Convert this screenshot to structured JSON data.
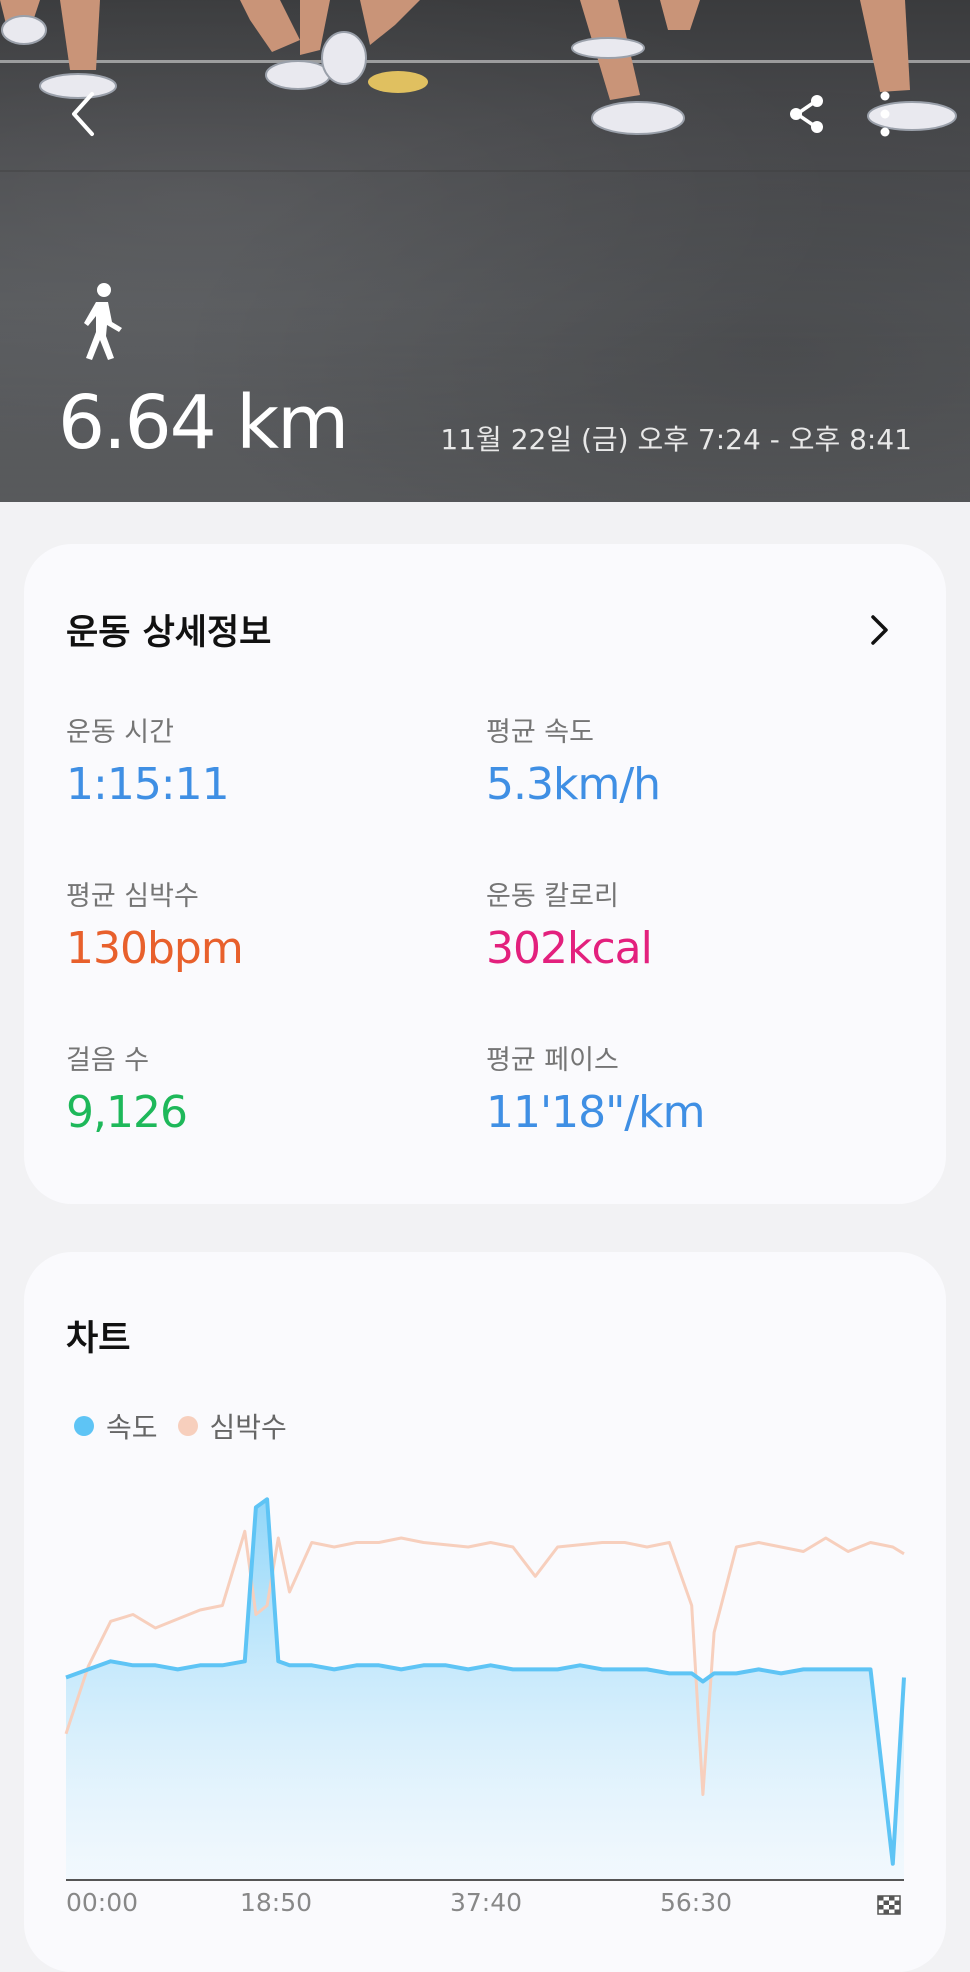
{
  "header": {
    "distance": "6.64 km",
    "datetime": "11월 22일 (금) 오후 7:24 - 오후 8:41",
    "icons": [
      "back-icon",
      "share-icon",
      "more-icon",
      "walking-icon"
    ]
  },
  "details": {
    "title": "운동 상세정보",
    "stats": {
      "duration": {
        "label": "운동 시간",
        "value": "1:15:11",
        "color": "#3f8fe4"
      },
      "avg_speed": {
        "label": "평균 속도",
        "value": "5.3km/h",
        "color": "#3f8fe4"
      },
      "avg_heart_rate": {
        "label": "평균 심박수",
        "value": "130bpm",
        "color": "#e8602c"
      },
      "calories": {
        "label": "운동 칼로리",
        "value": "302kcal",
        "color": "#e3207d"
      },
      "steps": {
        "label": "걸음 수",
        "value": "9,126",
        "color": "#1eb85a"
      },
      "avg_pace": {
        "label": "평균 페이스",
        "value": "11'18\"/km",
        "color": "#3f8fe4"
      }
    }
  },
  "chart": {
    "title": "차트",
    "legend": {
      "speed": "속도",
      "heart_rate": "심박수"
    },
    "colors": {
      "speed": "#5ec4f5",
      "heart_rate": "#f7cfbd"
    },
    "ticks": [
      "00:00",
      "18:50",
      "37:40",
      "56:30"
    ]
  },
  "chart_data": {
    "type": "area",
    "x": [
      0,
      2,
      4,
      6,
      8,
      10,
      12,
      14,
      16,
      17,
      18,
      19,
      20,
      22,
      24,
      26,
      28,
      30,
      32,
      34,
      36,
      38,
      40,
      42,
      44,
      46,
      48,
      50,
      52,
      54,
      56,
      57,
      58,
      60,
      62,
      64,
      66,
      68,
      70,
      72,
      74,
      75
    ],
    "xlabel": "",
    "ylabel": "",
    "series": [
      {
        "name": "속도",
        "values": [
          5.0,
          5.2,
          5.4,
          5.3,
          5.3,
          5.2,
          5.3,
          5.3,
          5.4,
          9.2,
          9.4,
          5.4,
          5.3,
          5.3,
          5.2,
          5.3,
          5.3,
          5.2,
          5.3,
          5.3,
          5.2,
          5.3,
          5.2,
          5.2,
          5.2,
          5.3,
          5.2,
          5.2,
          5.2,
          5.1,
          5.1,
          4.9,
          5.1,
          5.1,
          5.2,
          5.1,
          5.2,
          5.2,
          5.2,
          5.2,
          0.4,
          5.0
        ]
      },
      {
        "name": "심박수",
        "values": [
          65,
          95,
          115,
          118,
          112,
          116,
          120,
          122,
          155,
          118,
          122,
          152,
          128,
          150,
          148,
          150,
          150,
          152,
          150,
          149,
          148,
          150,
          148,
          135,
          148,
          149,
          150,
          150,
          148,
          150,
          122,
          38,
          110,
          148,
          150,
          148,
          146,
          152,
          146,
          150,
          148,
          145
        ]
      }
    ],
    "grid": false,
    "legend_placement": "top-left"
  }
}
